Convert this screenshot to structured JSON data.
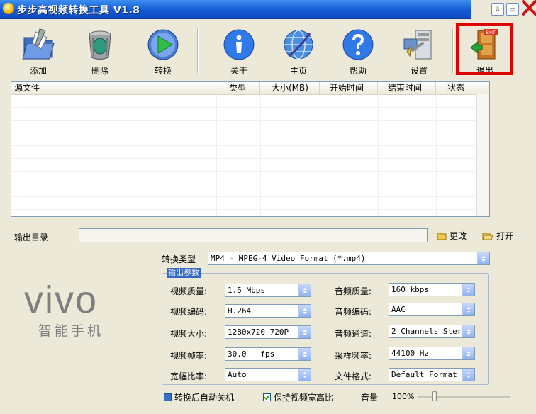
{
  "window": {
    "title": "步步高视频转换工具 V1.8",
    "minimize_icon": "minimize-icon",
    "maximize_icon": "maximize-icon",
    "close_icon": "close-x-icon"
  },
  "toolbar": {
    "items": [
      {
        "label": "添加",
        "icon": "add-folder-icon"
      },
      {
        "label": "删除",
        "icon": "trash-can-icon"
      },
      {
        "label": "转换",
        "icon": "play-convert-icon"
      },
      {
        "label": "关于",
        "icon": "info-icon"
      },
      {
        "label": "主页",
        "icon": "globe-icon"
      },
      {
        "label": "帮助",
        "icon": "help-icon"
      },
      {
        "label": "设置",
        "icon": "settings-computer-icon"
      },
      {
        "label": "退出",
        "icon": "exit-door-icon"
      }
    ],
    "highlighted": "退出",
    "highlight_color": "#e00000"
  },
  "file_list": {
    "columns": [
      "源文件",
      "类型",
      "大小(MB)",
      "开始时间",
      "结束时间",
      "状态"
    ],
    "rows": []
  },
  "output": {
    "label": "输出目录",
    "path": "",
    "change_label": "更改",
    "open_label": "打开"
  },
  "brand": {
    "logo_text": "vivo",
    "tagline": "智能手机",
    "color": "#7e7e7e"
  },
  "conversion": {
    "type_label": "转换类型",
    "type_value": "MP4 - MPEG-4 Video Format (*.mp4)",
    "params_title": "输出参数",
    "video_quality": {
      "label": "视频质量:",
      "value": "1.5 Mbps"
    },
    "video_codec": {
      "label": "视频编码:",
      "value": "H.264"
    },
    "video_size": {
      "label": "视频大小:",
      "value": "1280x720 720P"
    },
    "video_fps": {
      "label": "视频帧率:",
      "value": "30.0   fps"
    },
    "aspect_ratio": {
      "label": "宽幅比率:",
      "value": "Auto"
    },
    "audio_quality": {
      "label": "音频质量:",
      "value": "160 kbps"
    },
    "audio_codec": {
      "label": "音频编码:",
      "value": "AAC"
    },
    "audio_channels": {
      "label": "音频通道:",
      "value": "2 Channels Stere"
    },
    "sample_rate": {
      "label": "采样频率:",
      "value": "44100 Hz"
    },
    "file_format": {
      "label": "文件格式:",
      "value": "Default Format"
    }
  },
  "options": {
    "auto_shutdown_label": "转换后自动关机",
    "auto_shutdown_checked": false,
    "keep_aspect_label": "保持视频宽高比",
    "keep_aspect_checked": true,
    "volume_label": "音量",
    "volume_value": "100%",
    "volume_level": 0.18
  },
  "colors": {
    "titlebar": "#1559d6",
    "window_bg": "#ece9d8",
    "combo_arrow": "#8fb1f2",
    "group_title_bg": "#316ac5"
  }
}
